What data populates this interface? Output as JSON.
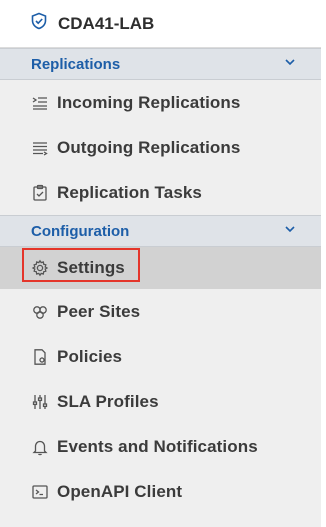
{
  "org": {
    "name": "CDA41-LAB",
    "icon": "shield-check-icon"
  },
  "sections": [
    {
      "label": "Replications",
      "items": [
        {
          "label": "Incoming Replications",
          "icon": "incoming-list-icon"
        },
        {
          "label": "Outgoing Replications",
          "icon": "outgoing-list-icon"
        },
        {
          "label": "Replication Tasks",
          "icon": "clipboard-check-icon"
        }
      ]
    },
    {
      "label": "Configuration",
      "items": [
        {
          "label": "Settings",
          "icon": "gear-icon",
          "active": true
        },
        {
          "label": "Peer Sites",
          "icon": "peer-sites-icon"
        },
        {
          "label": "Policies",
          "icon": "policy-icon"
        },
        {
          "label": "SLA Profiles",
          "icon": "sliders-icon"
        },
        {
          "label": "Events and Notifications",
          "icon": "bell-icon"
        },
        {
          "label": "OpenAPI Client",
          "icon": "terminal-icon"
        }
      ]
    }
  ],
  "colors": {
    "accent": "#1d5ea8",
    "highlight": "#e4352a",
    "active_bg": "#d2d2d2",
    "section_bg": "#dfe3e8"
  }
}
